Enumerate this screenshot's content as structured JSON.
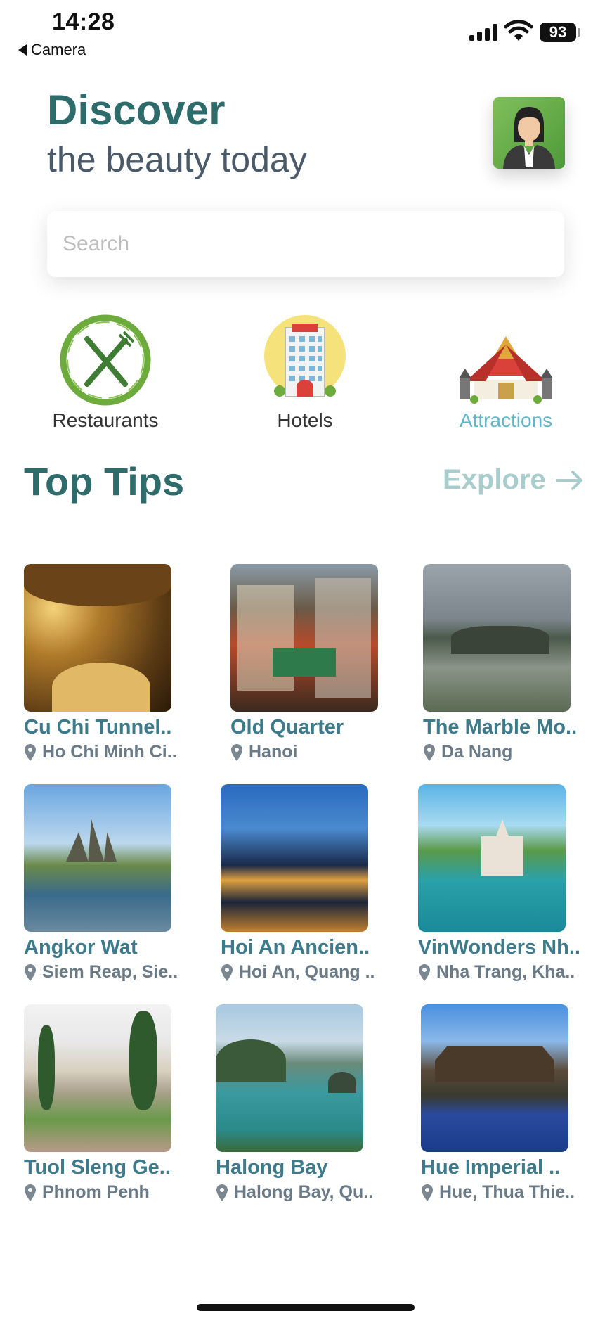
{
  "status": {
    "time": "14:28",
    "back_label": "Camera",
    "battery": "93"
  },
  "header": {
    "title": "Discover",
    "subtitle": "the beauty today"
  },
  "search": {
    "placeholder": "Search",
    "value": ""
  },
  "categories": [
    {
      "label": "Restaurants",
      "icon": "fork-knife-icon",
      "active": false
    },
    {
      "label": "Hotels",
      "icon": "hotel-building-icon",
      "active": false
    },
    {
      "label": "Attractions",
      "icon": "temple-icon",
      "active": true
    }
  ],
  "top_tips": {
    "title": "Top Tips",
    "explore_label": "Explore",
    "items": [
      {
        "title": "Cu Chi Tunnel..",
        "location": "Ho Chi Minh Ci.."
      },
      {
        "title": "Old Quarter",
        "location": "Hanoi"
      },
      {
        "title": "The Marble Mo..",
        "location": "Da Nang"
      },
      {
        "title": "Angkor Wat",
        "location": "Siem Reap, Sie.."
      },
      {
        "title": "Hoi An Ancien..",
        "location": "Hoi An, Quang .."
      },
      {
        "title": "VinWonders Nh..",
        "location": "Nha Trang, Kha.."
      },
      {
        "title": "Tuol Sleng Ge..",
        "location": "Phnom Penh"
      },
      {
        "title": "Halong Bay",
        "location": "Halong Bay, Qu.."
      },
      {
        "title": "Hue Imperial ..",
        "location": "Hue, Thua Thie.."
      }
    ]
  },
  "colors": {
    "accent": "#2e6b6b",
    "active_tab": "#5fb6c9",
    "title_text": "#3d7a8a"
  }
}
